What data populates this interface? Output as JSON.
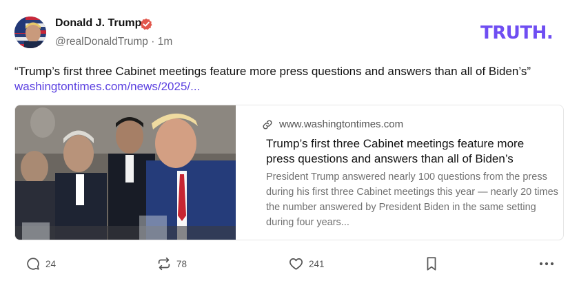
{
  "post": {
    "author_name": "Donald J. Trump",
    "handle": "@realDonaldTrump",
    "separator": "·",
    "time": "1m",
    "text": "“Trump’s first three Cabinet meetings feature more press questions and answers than all of Biden’s”",
    "link_text": "washingtontimes.com/news/2025/..."
  },
  "brand": {
    "logo_text": "TRUTH",
    "logo_dot": ".",
    "accent": "#6f4ef2",
    "link_color": "#5a3fe0"
  },
  "card": {
    "domain": "www.washingtontimes.com",
    "title": "Trump’s first three Cabinet meetings feature more press questions and answers than all of Biden’s",
    "description": "President Trump answered nearly 100 questions from the press during his first three Cabinet meetings this year — nearly 20 times the number answered by President Biden in the same setting during four years..."
  },
  "actions": {
    "replies": {
      "icon": "reply-icon",
      "count": "24"
    },
    "retruths": {
      "icon": "retruth-icon",
      "count": "78"
    },
    "likes": {
      "icon": "heart-icon",
      "count": "241"
    },
    "bookmark": {
      "icon": "bookmark-icon"
    },
    "more": {
      "icon": "more-icon"
    }
  }
}
